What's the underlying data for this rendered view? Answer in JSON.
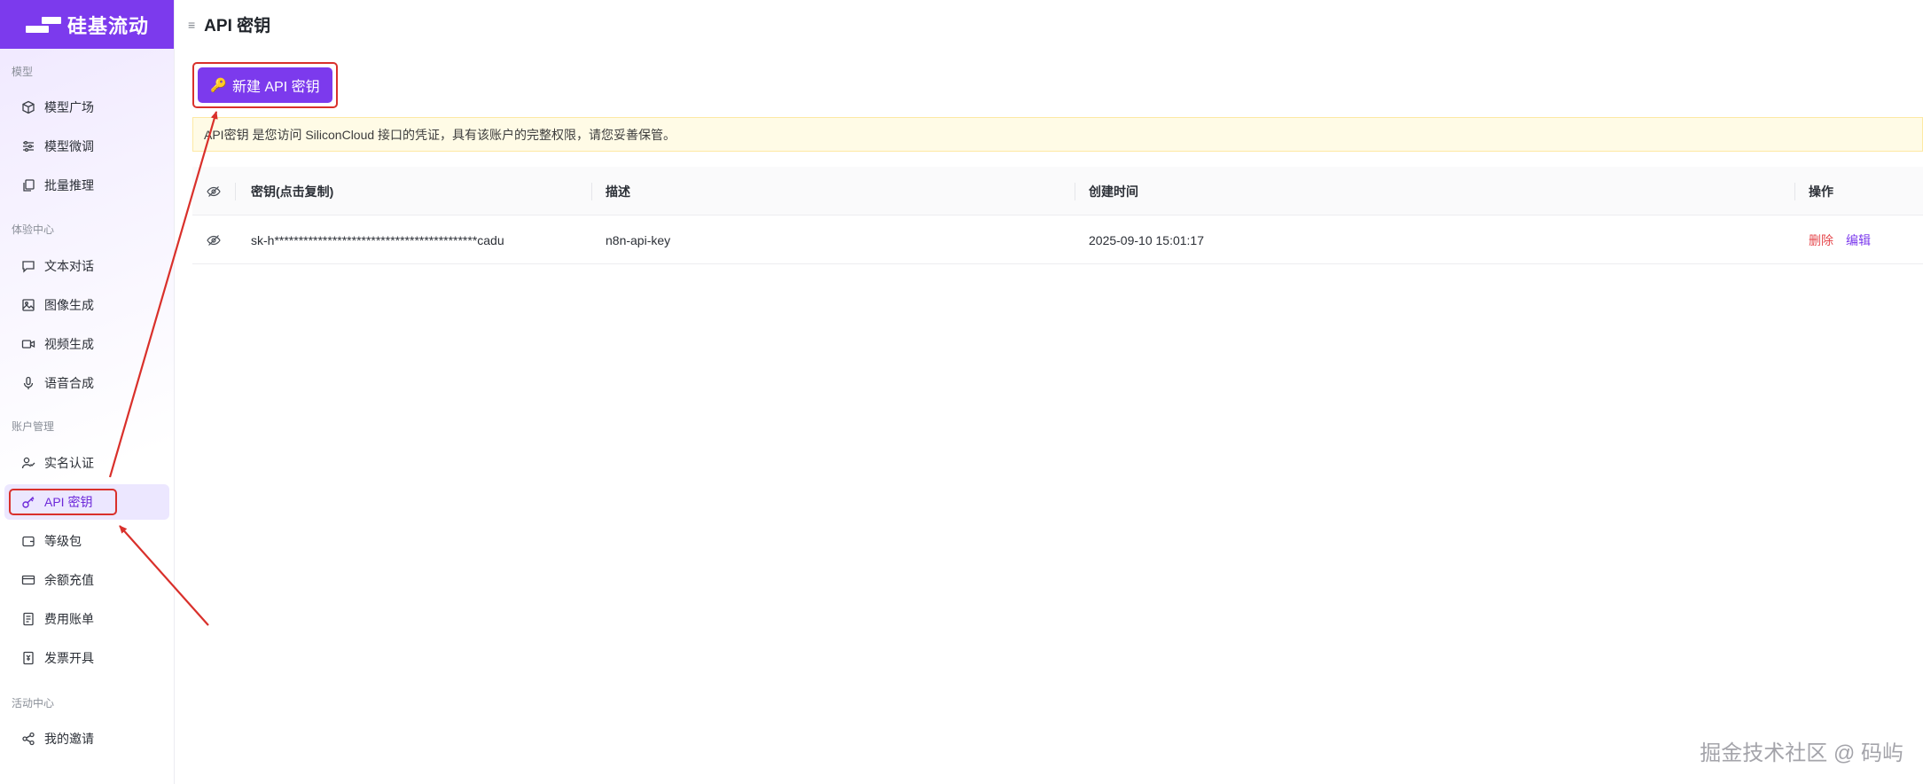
{
  "app": {
    "logo_text": "硅基流动"
  },
  "page": {
    "title": "API 密钥"
  },
  "sidebar": {
    "sections": [
      {
        "label": "模型"
      },
      {
        "label": "体验中心"
      },
      {
        "label": "账户管理"
      },
      {
        "label": "活动中心"
      }
    ],
    "items": [
      {
        "label": "模型广场",
        "icon": "cube-icon"
      },
      {
        "label": "模型微调",
        "icon": "sliders-icon"
      },
      {
        "label": "批量推理",
        "icon": "copy-icon"
      },
      {
        "label": "文本对话",
        "icon": "chat-icon"
      },
      {
        "label": "图像生成",
        "icon": "image-icon"
      },
      {
        "label": "视频生成",
        "icon": "video-icon"
      },
      {
        "label": "语音合成",
        "icon": "mic-icon"
      },
      {
        "label": "实名认证",
        "icon": "user-check-icon"
      },
      {
        "label": "API 密钥",
        "icon": "key-icon",
        "active": true
      },
      {
        "label": "等级包",
        "icon": "wallet-icon"
      },
      {
        "label": "余额充值",
        "icon": "card-icon"
      },
      {
        "label": "费用账单",
        "icon": "receipt-icon"
      },
      {
        "label": "发票开具",
        "icon": "invoice-icon"
      },
      {
        "label": "我的邀请",
        "icon": "share-icon"
      }
    ]
  },
  "toolbar": {
    "new_key_label": "新建 API 密钥"
  },
  "notice": {
    "text": "API密钥 是您访问 SiliconCloud 接口的凭证，具有该账户的完整权限，请您妥善保管。"
  },
  "table": {
    "headers": {
      "key": "密钥(点击复制)",
      "desc": "描述",
      "created": "创建时间",
      "actions": "操作"
    },
    "rows": [
      {
        "key": "sk-h******************************************cadu",
        "desc": "n8n-api-key",
        "created": "2025-09-10 15:01:17",
        "delete": "删除",
        "edit": "编辑"
      }
    ]
  },
  "colors": {
    "accent": "#7c3aed",
    "annotation": "#d9302b",
    "danger": "#e5484d"
  },
  "watermark": "掘金技术社区 @ 码屿"
}
